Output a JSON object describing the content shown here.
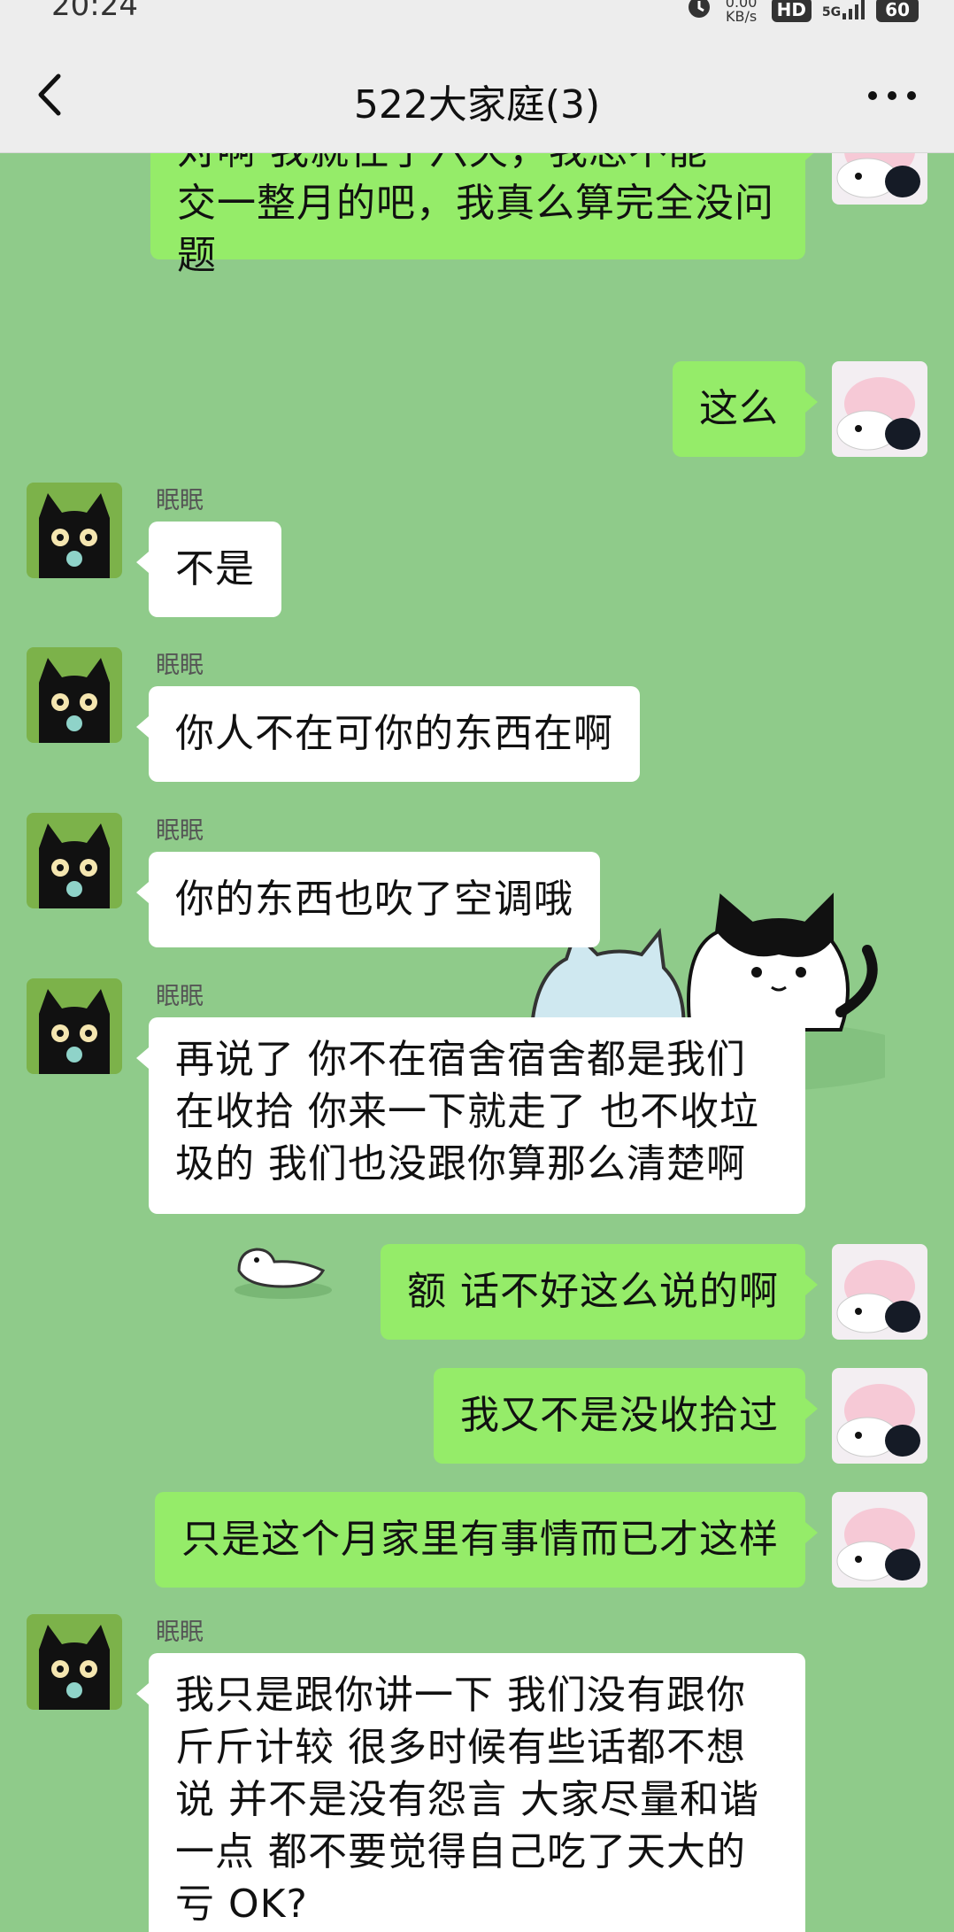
{
  "status_bar": {
    "time": "20:24",
    "net_speed": "0.00 KB/s",
    "hd": "HD",
    "network": "5G",
    "battery": "60"
  },
  "header": {
    "title": "522大家庭(3)"
  },
  "messages": [
    {
      "side": "out",
      "text": "对啊 我就住了六天，我总不能一交一整月的吧，我真么算完全没问题"
    },
    {
      "side": "out",
      "text": "这么"
    },
    {
      "side": "in",
      "sender": "眠眠",
      "text": "不是"
    },
    {
      "side": "in",
      "sender": "眠眠",
      "text": "你人不在可你的东西在啊"
    },
    {
      "side": "in",
      "sender": "眠眠",
      "text": "你的东西也吹了空调哦"
    },
    {
      "side": "in",
      "sender": "眠眠",
      "text": "再说了 你不在宿舍宿舍都是我们在收拾 你来一下就走了 也不收垃圾的 我们也没跟你算那么清楚啊"
    },
    {
      "side": "out",
      "text": "额 话不好这么说的啊"
    },
    {
      "side": "out",
      "text": "我又不是没收拾过"
    },
    {
      "side": "out",
      "text": "只是这个月家里有事情而已才这样"
    },
    {
      "side": "in",
      "sender": "眠眠",
      "text": "我只是跟你讲一下 我们没有跟你斤斤计较 很多时候有些话都不想说 并不是没有怨言 大家尽量和谐一点 都不要觉得自己吃了天大的亏 OK?"
    }
  ]
}
